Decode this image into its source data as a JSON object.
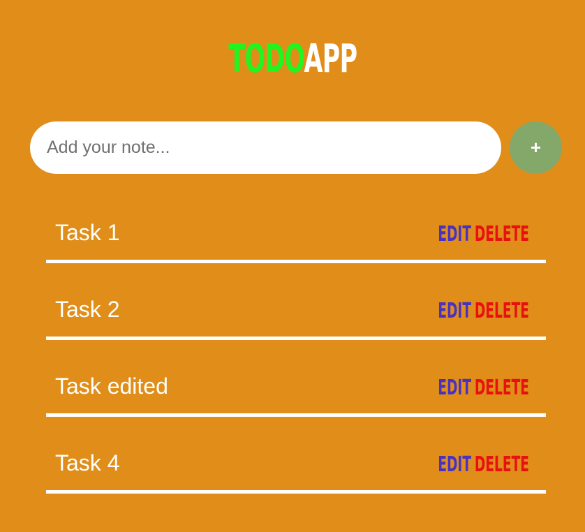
{
  "header": {
    "title_part1": "TODO",
    "title_part2": "APP"
  },
  "form": {
    "input_value": "",
    "input_placeholder": "Add your note...",
    "add_button_label": "+"
  },
  "tasks": [
    {
      "text": "Task 1",
      "edit_label": "EDIT",
      "delete_label": "DELETE"
    },
    {
      "text": "Task 2",
      "edit_label": "EDIT",
      "delete_label": "DELETE"
    },
    {
      "text": "Task edited",
      "edit_label": "EDIT",
      "delete_label": "DELETE"
    },
    {
      "text": "Task 4",
      "edit_label": "EDIT",
      "delete_label": "DELETE"
    }
  ],
  "colors": {
    "background": "#e08e19",
    "title_todo": "#22f422",
    "title_app": "#ffffff",
    "add_button": "#84a869",
    "edit": "#4a32c0",
    "delete": "#e81010"
  }
}
